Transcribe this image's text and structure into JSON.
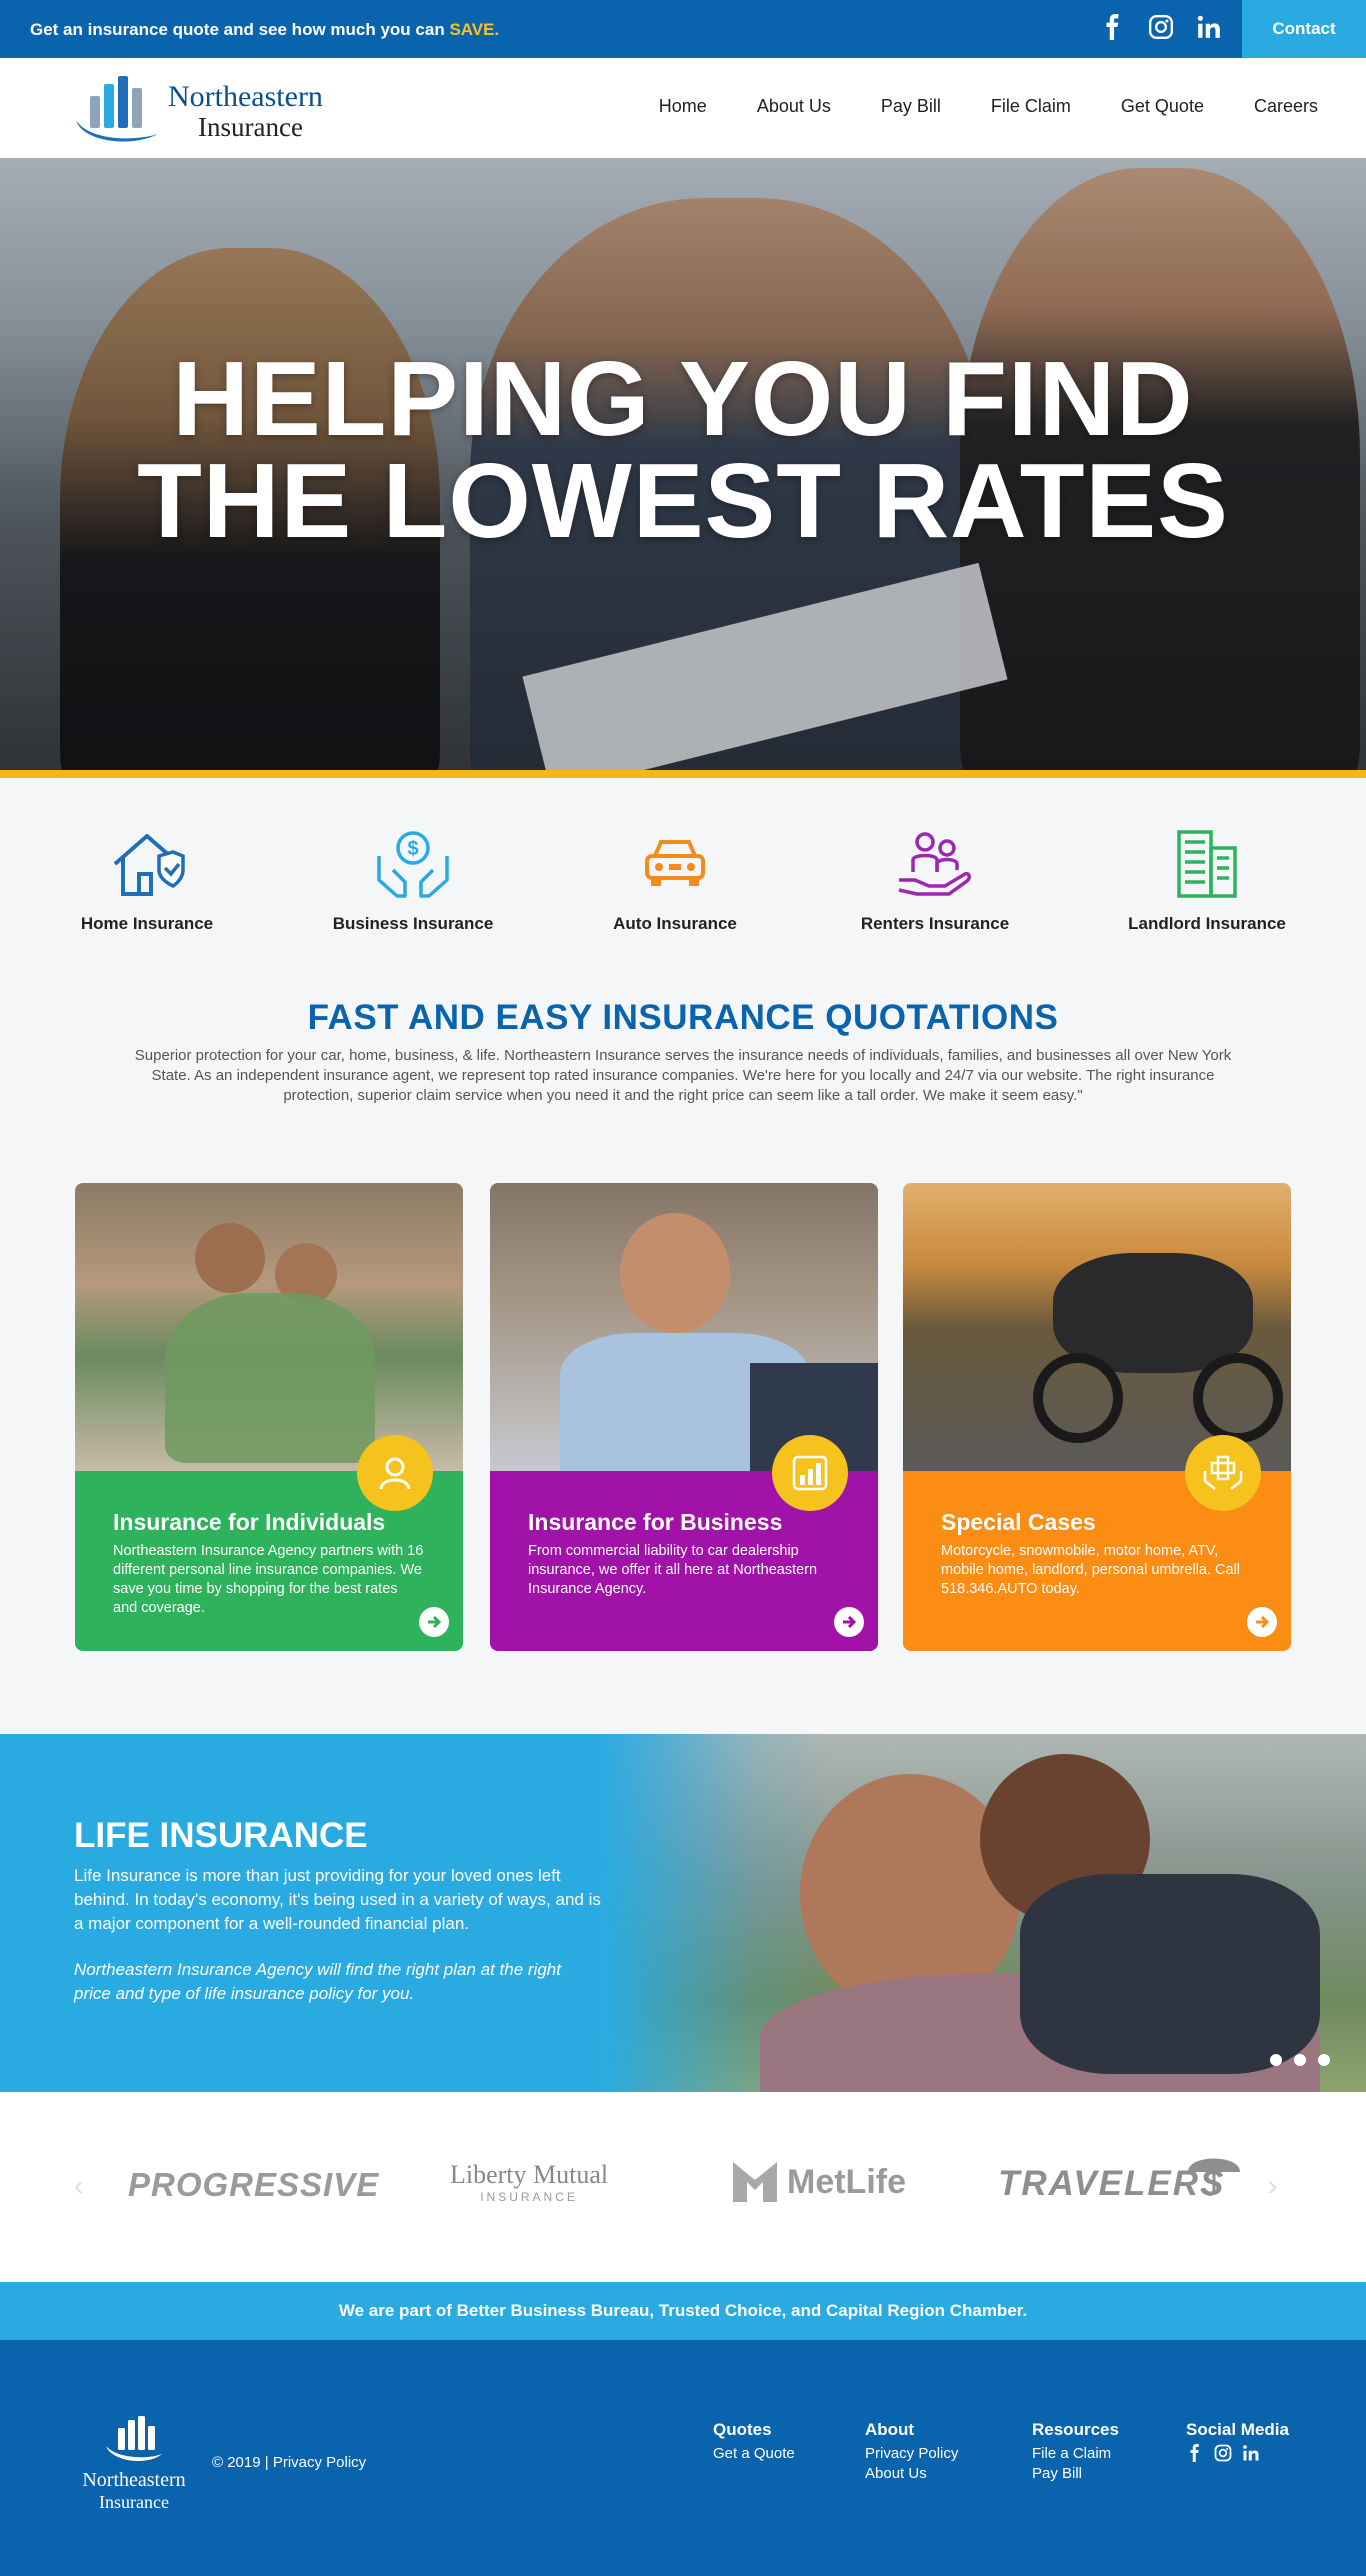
{
  "topbar": {
    "promo_text": "Get an insurance quote and see how much you can",
    "promo_highlight": "SAVE.",
    "contact_label": "Contact",
    "social_icons": [
      "facebook-icon",
      "instagram-icon",
      "linkedin-icon"
    ]
  },
  "header": {
    "brand_line1": "Northeastern",
    "brand_line2": "Insurance",
    "nav": [
      "Home",
      "About Us",
      "Pay Bill",
      "File Claim",
      "Get Quote",
      "Careers"
    ]
  },
  "hero": {
    "headline_line1": "HELPING YOU FIND",
    "headline_line2": "THE LOWEST RATES"
  },
  "categories": [
    {
      "label": "Home Insurance",
      "icon": "house-shield-icon",
      "color": "#1f6fb8"
    },
    {
      "label": "Business Insurance",
      "icon": "hands-dollar-icon",
      "color": "#29abe2"
    },
    {
      "label": "Auto Insurance",
      "icon": "car-icon",
      "color": "#f28c1d"
    },
    {
      "label": "Renters Insurance",
      "icon": "family-hand-icon",
      "color": "#9c27b0"
    },
    {
      "label": "Landlord Insurance",
      "icon": "building-icon",
      "color": "#2eb25c"
    }
  ],
  "quotations": {
    "title": "FAST AND EASY INSURANCE QUOTATIONS",
    "text": "Superior protection for your car, home, business, & life. Northeastern Insurance serves the insurance needs of individuals, families, and businesses all over New York State. As an independent insurance agent, we represent top rated insurance companies. We're here for you locally and 24/7 via our website. The right insurance protection, superior claim service when you need it and the right price can seem like a tall order. We make it seem easy.\""
  },
  "cards": [
    {
      "title": "Insurance for Individuals",
      "text": "Northeastern Insurance Agency partners with 16 different personal line insurance companies. We save you time by shopping for the best rates and coverage.",
      "color": "#2eb25c",
      "icon": "person-badge-icon"
    },
    {
      "title": "Insurance for Business",
      "text": "From commercial liability to car dealership insurance, we offer it all here at Northeastern Insurance Agency.",
      "color": "#a012a8",
      "icon": "bar-chart-badge-icon"
    },
    {
      "title": "Special Cases",
      "text": "Motorcycle, snowmobile, motor home, ATV, mobile home, landlord, personal umbrella. Call 518.346.AUTO today.",
      "color": "#fb8c14",
      "icon": "hands-plus-badge-icon"
    }
  ],
  "life": {
    "title": "LIFE INSURANCE",
    "text1": "Life Insurance is more than just providing for your loved ones left behind. In today's economy, it's being used in a variety of ways, and is a major component for a well-rounded financial plan.",
    "text2": "Northeastern Insurance Agency will find the right plan at the right price and type of life insurance policy for you."
  },
  "partners": [
    "PROGRESSIVE",
    "Liberty Mutual",
    "INSURANCE",
    "MetLife",
    "TRAVELERS"
  ],
  "bbb_text": "We are part of Better Business Bureau, Trusted Choice, and Capital Region Chamber.",
  "footer": {
    "logo_line1": "Northeastern",
    "logo_line2": "Insurance",
    "copyright": "© 2019 | Privacy Policy",
    "columns": [
      {
        "title": "Quotes",
        "links": [
          "Get a Quote"
        ]
      },
      {
        "title": "About",
        "links": [
          "Privacy Policy",
          "About Us"
        ]
      },
      {
        "title": "Resources",
        "links": [
          "File a Claim",
          "Pay Bill"
        ]
      },
      {
        "title": "Social Media",
        "links": []
      }
    ]
  }
}
